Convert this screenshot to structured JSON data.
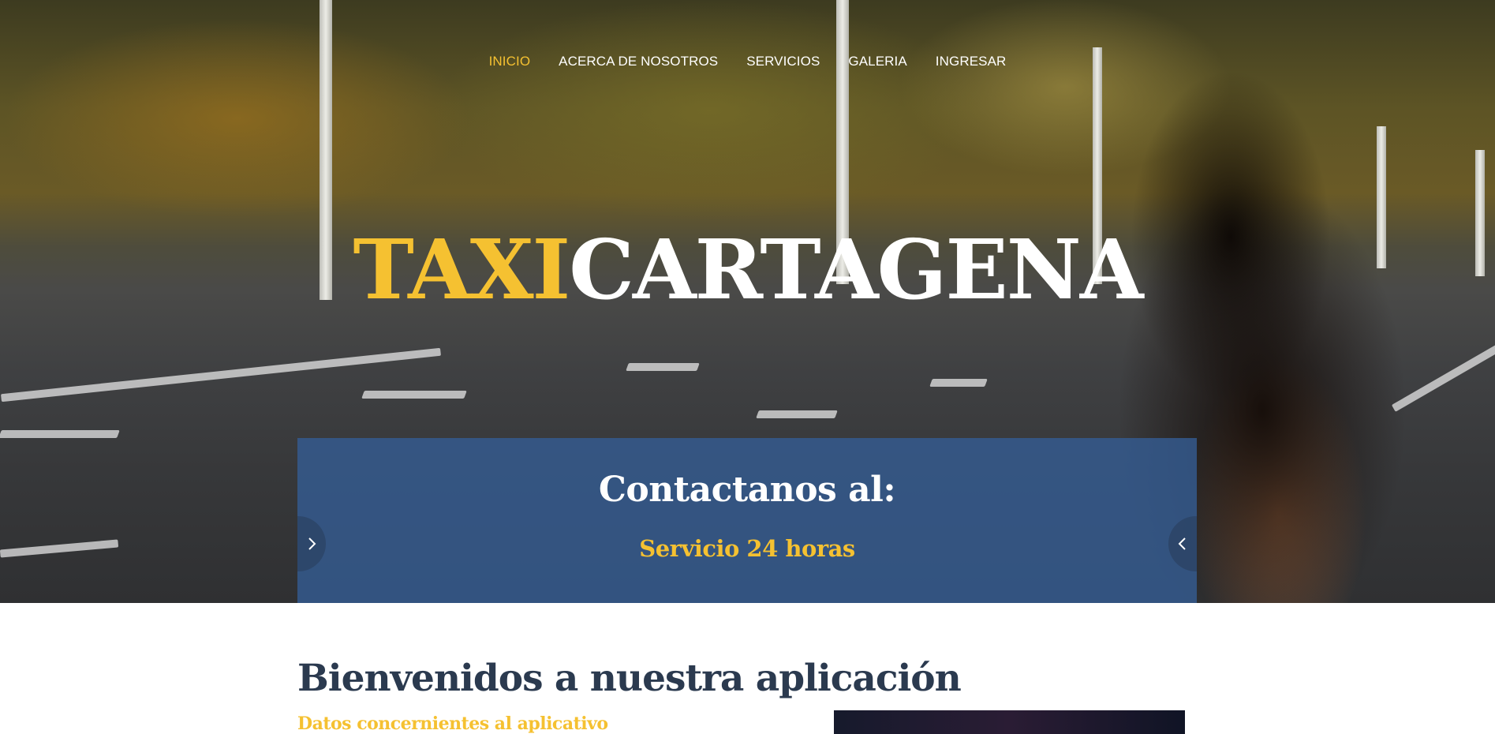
{
  "nav": {
    "items": [
      {
        "label": "INICIO",
        "active": true
      },
      {
        "label": "ACERCA DE NOSOTROS",
        "active": false
      },
      {
        "label": "SERVICIOS",
        "active": false
      },
      {
        "label": "GALERIA",
        "active": false
      },
      {
        "label": "INGRESAR",
        "active": false
      }
    ]
  },
  "hero": {
    "brand_part1": "TAXI",
    "brand_part2": "CARTAGENA",
    "contact_title": "Contactanos al:",
    "contact_subtitle": "Servicio 24 horas",
    "prev_icon": "chevron-right-icon",
    "next_icon": "chevron-left-icon"
  },
  "intro": {
    "title": "Bienvenidos a nuestra aplicación",
    "subtitle": "Datos concernientes al aplicativo"
  },
  "colors": {
    "accent": "#f5c131",
    "contact_box": "#355c91",
    "heading": "#2b3a4f"
  }
}
